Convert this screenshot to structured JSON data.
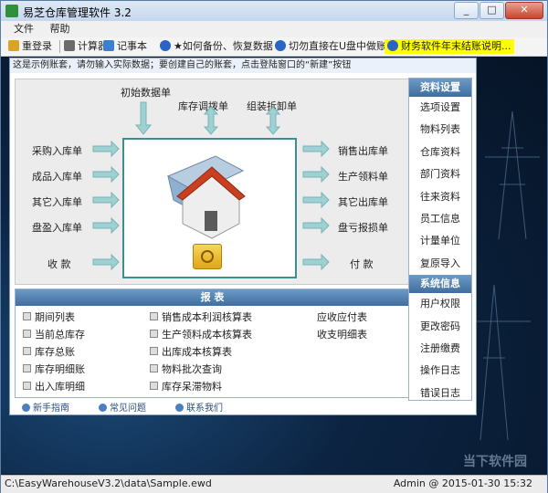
{
  "window": {
    "title": "易芝仓库管理软件 3.2"
  },
  "menu": [
    "文件",
    "帮助"
  ],
  "toolbar": {
    "login": "重登录",
    "calculator": "计算器",
    "notepad": "记事本",
    "backup": "★如何备份、恢复数据",
    "usb_warning": "切勿直接在U盘中做账",
    "yearend": "财务软件年末结账说明..."
  },
  "hint": "这是示例账套，请勿输入实际数据；要创建自己的账套，点击登陆窗口的“新建”按钮",
  "flow": {
    "top": [
      "初始数据单",
      "库存调拨单",
      "组装拆卸单"
    ],
    "left": [
      "采购入库单",
      "成品入库单",
      "其它入库单",
      "盘盈入库单",
      "收  款"
    ],
    "right": [
      "销售出库单",
      "生产领料单",
      "其它出库单",
      "盘亏报损单",
      "付  款"
    ]
  },
  "sidebar": {
    "section1": "资料设置",
    "items1": [
      "选项设置",
      "物料列表",
      "仓库资料",
      "部门资料",
      "往来资料",
      "员工信息",
      "计量单位",
      "复原导入"
    ],
    "section2": "系统信息",
    "items2": [
      "用户权限",
      "更改密码",
      "注册缴费",
      "操作日志",
      "错误日志"
    ]
  },
  "reports": {
    "title": "报  表",
    "col1": [
      "期间列表",
      "当前总库存",
      "库存总账",
      "库存明细账",
      "出入库明细"
    ],
    "col2": [
      "销售成本利润核算表",
      "生产领料成本核算表",
      "出库成本核算表",
      "物料批次查询",
      "库存呆滞物料"
    ],
    "col3": [
      "应收应付表",
      "收支明细表"
    ]
  },
  "links": [
    "新手指南",
    "常见问题",
    "联系我们"
  ],
  "status": {
    "path": "C:\\EasyWarehouseV3.2\\data\\Sample.ewd",
    "user": "Admin @ 2015-01-30 15:32"
  },
  "watermark": "当下软件园",
  "colors": {
    "accent": "#3f6e9e",
    "highlight": "#ffff00",
    "frame": "#3a8f93",
    "arrow": "#9fd0d2"
  }
}
